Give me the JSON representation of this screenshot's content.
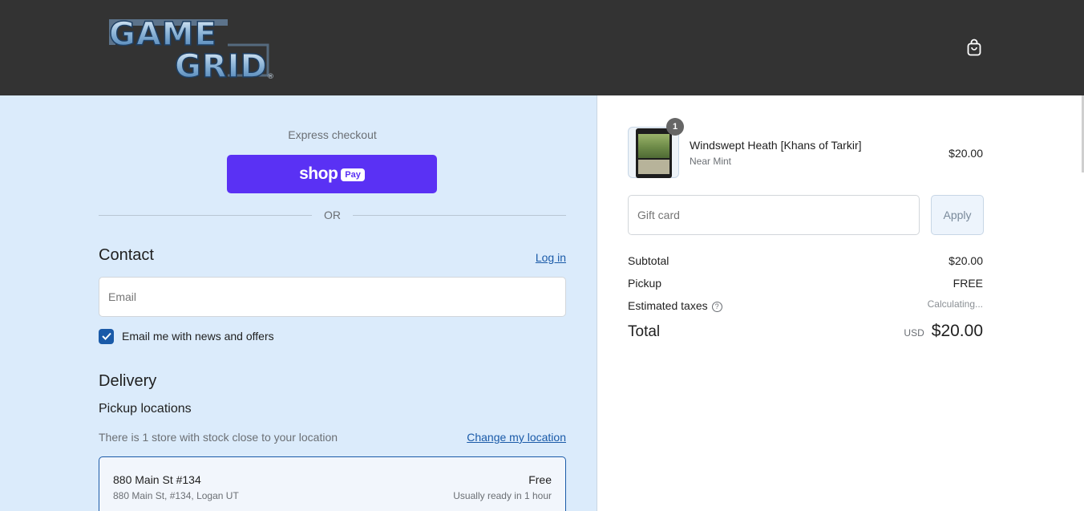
{
  "header": {
    "logo_text_line1": "GAME",
    "logo_text_line2": "GRID",
    "logo_mark": "®",
    "cart_icon": "shopping-bag-icon"
  },
  "express": {
    "label": "Express checkout",
    "shop_word": "shop",
    "pay_word": "Pay",
    "or": "OR"
  },
  "contact": {
    "title": "Contact",
    "login_link": "Log in",
    "email_placeholder": "Email",
    "newsletter_label": "Email me with news and offers",
    "newsletter_checked": true
  },
  "delivery": {
    "title": "Delivery",
    "pickup_title": "Pickup locations",
    "stock_note": "There is 1 store with stock close to your location",
    "change_location": "Change my location",
    "location": {
      "name": "880 Main St #134",
      "address": "880 Main St, #134, Logan UT",
      "price": "Free",
      "ready": "Usually ready in 1 hour"
    }
  },
  "order": {
    "item": {
      "name": "Windswept Heath [Khans of Tarkir]",
      "variant": "Near Mint",
      "price": "$20.00",
      "quantity": "1"
    },
    "gift_card_placeholder": "Gift card",
    "apply_label": "Apply",
    "summary": {
      "subtotal_label": "Subtotal",
      "subtotal": "$20.00",
      "pickup_label": "Pickup",
      "pickup": "FREE",
      "taxes_label": "Estimated taxes",
      "taxes": "Calculating...",
      "total_label": "Total",
      "currency": "USD",
      "total": "$20.00"
    }
  },
  "colors": {
    "header_bg": "#333333",
    "left_bg": "#dbebfb",
    "shop_pay": "#5a31f4",
    "link": "#1a5aa8"
  }
}
